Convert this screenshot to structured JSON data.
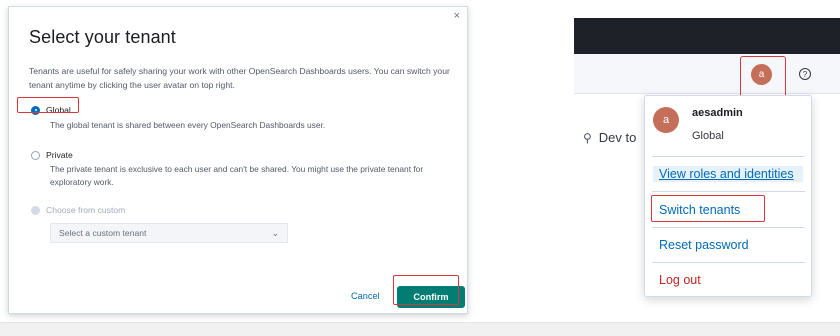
{
  "modal": {
    "title": "Select your tenant",
    "close_glyph": "×",
    "description": "Tenants are useful for safely sharing your work with other OpenSearch Dashboards users. You can switch your tenant anytime by clicking the user avatar on top right.",
    "options": [
      {
        "label": "Global",
        "help": "The global tenant is shared between every OpenSearch Dashboards user.",
        "selected": true
      },
      {
        "label": "Private",
        "help": "The private tenant is exclusive to each user and can't be shared. You might use the private tenant for exploratory work.",
        "selected": false
      },
      {
        "label": "Choose from custom",
        "help": "",
        "selected": false,
        "disabled": true
      }
    ],
    "custom_select_placeholder": "Select a custom tenant",
    "cancel_label": "Cancel",
    "confirm_label": "Confirm"
  },
  "app": {
    "avatar_initial": "a",
    "help_glyph": "?",
    "dev_tools_label": "Dev to",
    "popover": {
      "username": "aesadmin",
      "tenant": "Global",
      "items": [
        "View roles and identities",
        "Switch tenants",
        "Reset password",
        "Log out"
      ]
    }
  },
  "colors": {
    "primary": "#006bb8",
    "confirm": "#017d73",
    "highlight": "#d9363e",
    "avatar": "#c56e5a",
    "header": "#1e2228",
    "danger": "#bd271e"
  },
  "icons": [
    "close-icon",
    "radio-icon",
    "chevron-down-icon",
    "help-icon",
    "wrench-icon"
  ]
}
